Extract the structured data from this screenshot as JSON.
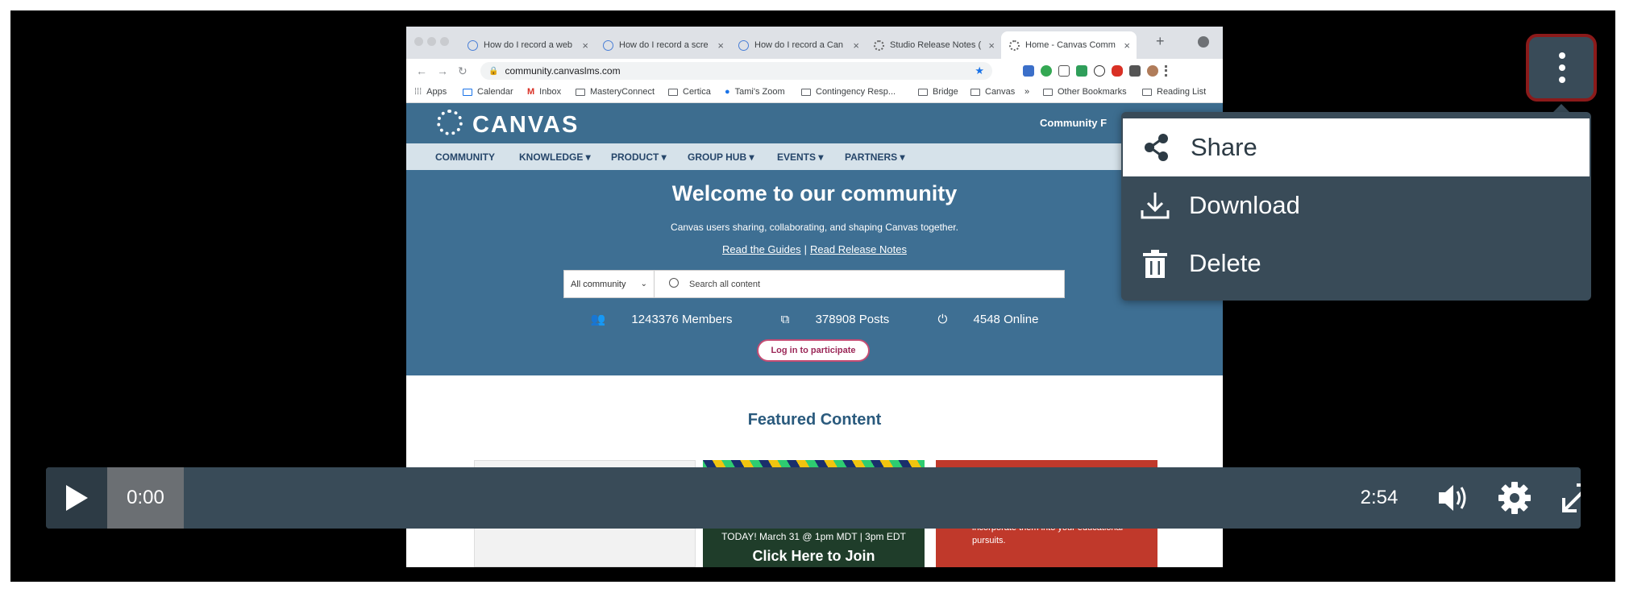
{
  "browser": {
    "tabs": [
      {
        "title": "How do I record a web"
      },
      {
        "title": "How do I record a scre"
      },
      {
        "title": "How do I record a Can"
      },
      {
        "title": "Studio Release Notes ("
      },
      {
        "title": "Home - Canvas Comm"
      }
    ],
    "url": "community.canvaslms.com",
    "bookmarks": [
      "Apps",
      "Calendar",
      "Inbox",
      "MasteryConnect",
      "Certica",
      "Tami's Zoom",
      "Contingency Resp...",
      "Bridge",
      "Canvas",
      "»",
      "Other Bookmarks",
      "Reading List"
    ]
  },
  "site": {
    "logo": "CANVAS",
    "header_right": "Community F",
    "nav": [
      "COMMUNITY",
      "KNOWLEDGE ▾",
      "PRODUCT ▾",
      "GROUP HUB ▾",
      "EVENTS ▾",
      "PARTNERS ▾"
    ],
    "hero_title": "Welcome to our community",
    "hero_tagline": "Canvas users sharing, collaborating, and shaping Canvas together.",
    "link_guides": "Read the Guides",
    "link_release": "Read Release Notes",
    "search_scope": "All community",
    "search_placeholder": "Search all content",
    "members": "1243376 Members",
    "posts": "378908 Posts",
    "online": "4548 Online",
    "login_label": "Log in to participate",
    "featured_title": "Featured Content",
    "card2_line1": "TODAY! March 31 @ 1pm MDT | 3pm EDT",
    "card2_line2": "Click Here to Join",
    "card3_text": "partners have created and now you can incorporate them into your educational pursuits."
  },
  "player": {
    "current_time": "0:00",
    "total_time": "2:54",
    "icons": [
      "play-icon",
      "volume-icon",
      "settings-gear-icon",
      "fullscreen-icon",
      "more-options-icon"
    ]
  },
  "menu": {
    "items": [
      {
        "label": "Share",
        "icon": "share-icon"
      },
      {
        "label": "Download",
        "icon": "download-icon"
      },
      {
        "label": "Delete",
        "icon": "trash-icon"
      }
    ]
  },
  "colors": {
    "menu_bg": "#394b58",
    "highlight_border": "#8b1a1a",
    "canvas_blue": "#3e6f93"
  }
}
